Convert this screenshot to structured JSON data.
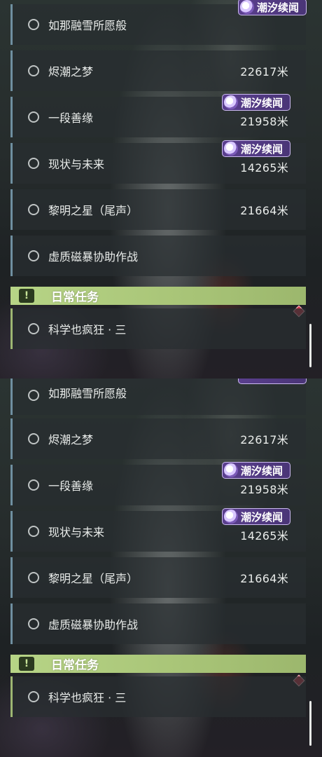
{
  "panels": [
    {
      "quests": [
        {
          "label": "如那融雪所愿般",
          "distance": "",
          "badge": "潮汐续闻"
        },
        {
          "label": "烬潮之梦",
          "distance": "22617米",
          "badge": ""
        },
        {
          "label": "一段善缘",
          "distance": "21958米",
          "badge": "潮汐续闻"
        },
        {
          "label": "现状与未来",
          "distance": "14265米",
          "badge": "潮汐续闻"
        },
        {
          "label": "黎明之星（尾声）",
          "distance": "21664米",
          "badge": ""
        },
        {
          "label": "虚质磁暴协助作战",
          "distance": "",
          "badge": ""
        }
      ],
      "daily_header": {
        "icon": "!",
        "title": "日常任务"
      },
      "daily_quests": [
        {
          "label": "科学也疯狂 · 三"
        }
      ]
    },
    {
      "quests": [
        {
          "label": "如那融雪所愿般",
          "distance": "",
          "badge": ""
        },
        {
          "label": "烬潮之梦",
          "distance": "22617米",
          "badge": ""
        },
        {
          "label": "一段善缘",
          "distance": "21958米",
          "badge": "潮汐续闻"
        },
        {
          "label": "现状与未来",
          "distance": "14265米",
          "badge": "潮汐续闻"
        },
        {
          "label": "黎明之星（尾声）",
          "distance": "21664米",
          "badge": ""
        },
        {
          "label": "虚质磁暴协助作战",
          "distance": "",
          "badge": ""
        }
      ],
      "daily_header": {
        "icon": "!",
        "title": "日常任务"
      },
      "daily_quests": [
        {
          "label": "科学也疯狂 · 三"
        }
      ]
    }
  ],
  "colors": {
    "row_bar": "#6f8fa0",
    "daily_bar": "#9db672",
    "daily_header": "#b7d486",
    "badge_bg": "#5a3f8e",
    "marker": "#d1364a"
  }
}
